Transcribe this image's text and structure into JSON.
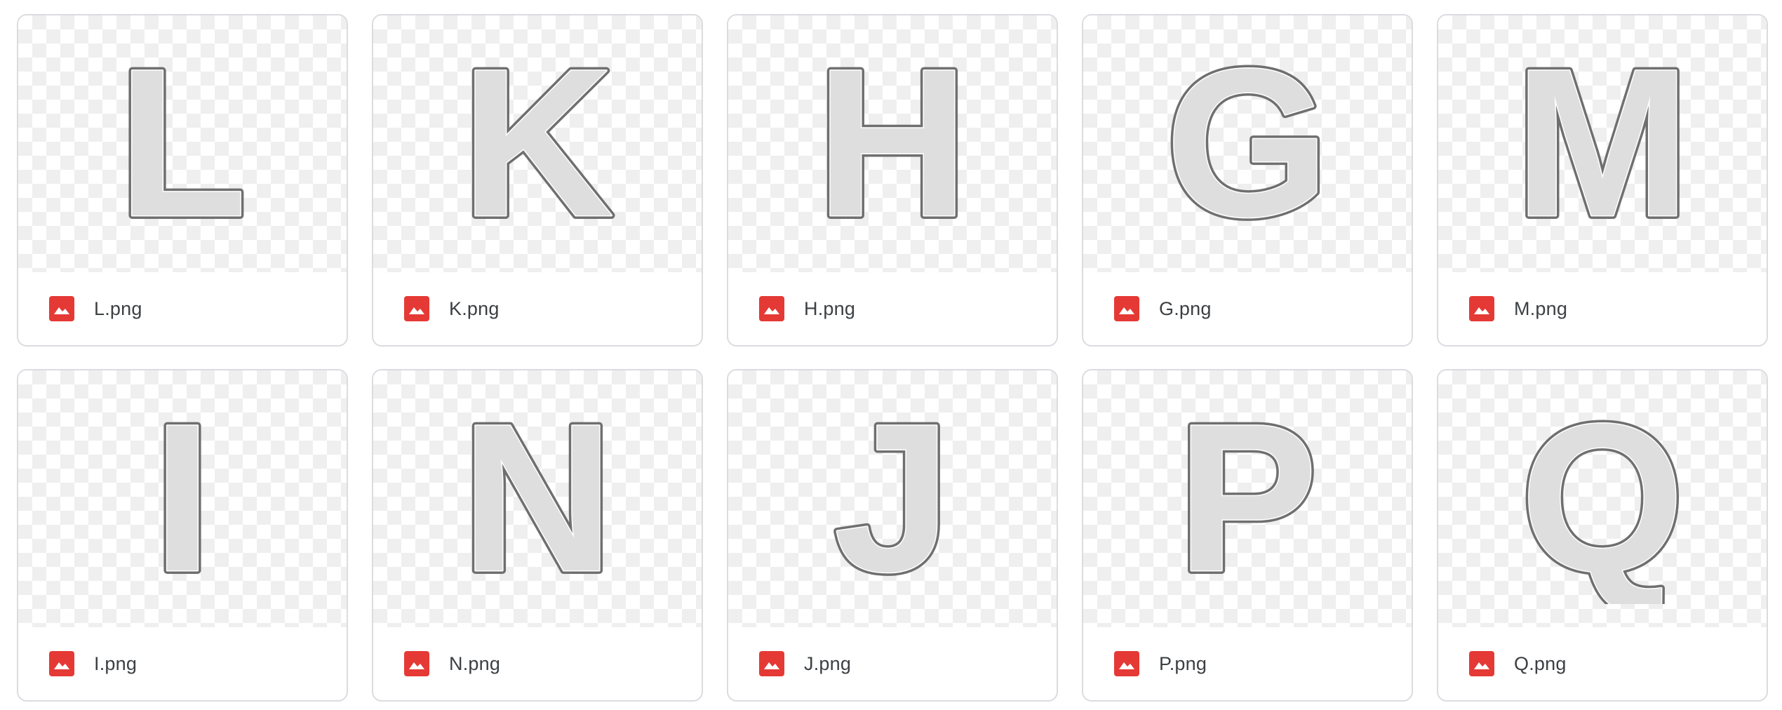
{
  "colors": {
    "image_icon": "#e53935",
    "card_border": "#dadce0",
    "filename_text": "#3c4043",
    "balloon_fill": "#dedede",
    "balloon_outline": "#6f6f6f"
  },
  "file_icon_name": "image-file-icon",
  "files": [
    {
      "letter": "L",
      "name": "L.png"
    },
    {
      "letter": "K",
      "name": "K.png"
    },
    {
      "letter": "H",
      "name": "H.png"
    },
    {
      "letter": "G",
      "name": "G.png"
    },
    {
      "letter": "M",
      "name": "M.png"
    },
    {
      "letter": "I",
      "name": "I.png"
    },
    {
      "letter": "N",
      "name": "N.png"
    },
    {
      "letter": "J",
      "name": "J.png"
    },
    {
      "letter": "P",
      "name": "P.png"
    },
    {
      "letter": "Q",
      "name": "Q.png"
    }
  ]
}
